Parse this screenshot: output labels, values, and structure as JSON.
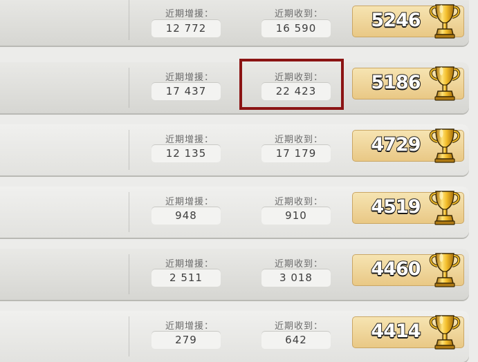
{
  "stat_labels": {
    "donated": "近期增援：",
    "received": "近期收到："
  },
  "rows": [
    {
      "donated": "12 772",
      "received": "16 590",
      "trophies": "5246"
    },
    {
      "donated": "17 437",
      "received": "22 423",
      "trophies": "5186"
    },
    {
      "donated": "12 135",
      "received": "17 179",
      "trophies": "4729"
    },
    {
      "donated": "948",
      "received": "910",
      "trophies": "4519"
    },
    {
      "donated": "2 511",
      "received": "3 018",
      "trophies": "4460"
    },
    {
      "donated": "279",
      "received": "642",
      "trophies": "4414"
    }
  ],
  "colors": {
    "highlight": "#8b1414",
    "trophy_box": "#efd79c",
    "trophy_gold": "#e8b321"
  },
  "icons": {
    "trophy": "trophy-icon",
    "clan_member_badge": "member-badge-icon"
  }
}
